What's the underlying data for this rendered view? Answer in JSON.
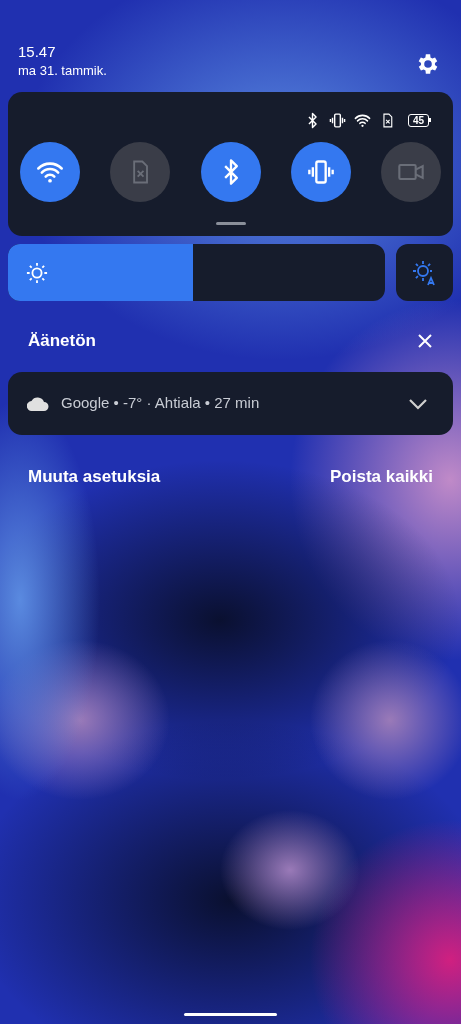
{
  "header": {
    "time": "15.47",
    "date": "ma 31. tammik."
  },
  "status_icons": [
    {
      "kind": "bluetooth"
    },
    {
      "kind": "vibrate"
    },
    {
      "kind": "wifi"
    },
    {
      "kind": "sim"
    },
    {
      "kind": "battery",
      "text": "45"
    }
  ],
  "tiles": [
    {
      "kind": "wifi",
      "on": true
    },
    {
      "kind": "sim",
      "on": false
    },
    {
      "kind": "bluetooth",
      "on": true
    },
    {
      "kind": "vibrate",
      "on": true
    },
    {
      "kind": "video",
      "on": false
    }
  ],
  "brightness": {
    "level": 0.49
  },
  "section": {
    "title": "Äänetön"
  },
  "notification": {
    "text": "Google • -7° · Ahtiala • 27 min"
  },
  "footer": {
    "left": "Muuta asetuksia",
    "right": "Poista kaikki"
  }
}
